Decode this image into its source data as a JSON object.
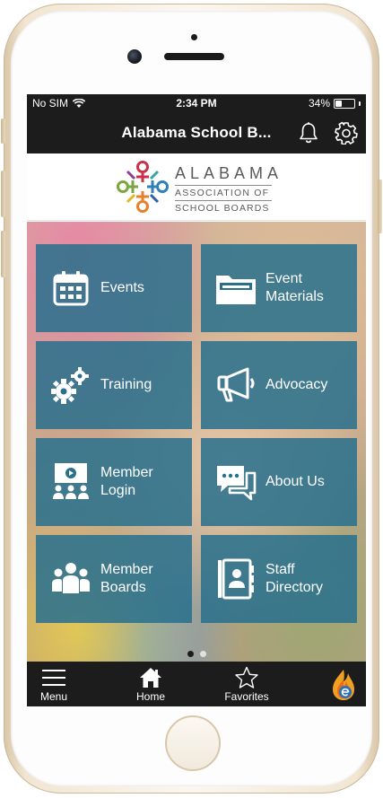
{
  "status_bar": {
    "carrier": "No SIM",
    "time": "2:34 PM",
    "battery_percent": "34%",
    "battery_level": 0.34
  },
  "nav": {
    "title": "Alabama School B...",
    "notification_icon": "bell-icon",
    "settings_icon": "gear-icon"
  },
  "logo": {
    "line1": "ALABAMA",
    "line2": "ASSOCIATION OF",
    "line3": "SCHOOL BOARDS"
  },
  "tiles": [
    {
      "label": "Events",
      "icon": "calendar-icon"
    },
    {
      "label": "Event\nMaterials",
      "icon": "folder-icon"
    },
    {
      "label": "Training",
      "icon": "gears-icon"
    },
    {
      "label": "Advocacy",
      "icon": "megaphone-icon"
    },
    {
      "label": "Member\nLogin",
      "icon": "presentation-icon"
    },
    {
      "label": "About Us",
      "icon": "chat-bubbles-icon"
    },
    {
      "label": "Member\nBoards",
      "icon": "group-icon"
    },
    {
      "label": "Staff\nDirectory",
      "icon": "contact-book-icon"
    }
  ],
  "pager": {
    "pages": 2,
    "current": 1
  },
  "tab_bar": [
    {
      "label": "Menu",
      "icon": "hamburger-icon"
    },
    {
      "label": "Home",
      "icon": "home-icon"
    },
    {
      "label": "Favorites",
      "icon": "star-icon"
    }
  ],
  "colors": {
    "tile": "#29708d",
    "bar": "#1c1c1c",
    "text_light": "#ffffff"
  }
}
